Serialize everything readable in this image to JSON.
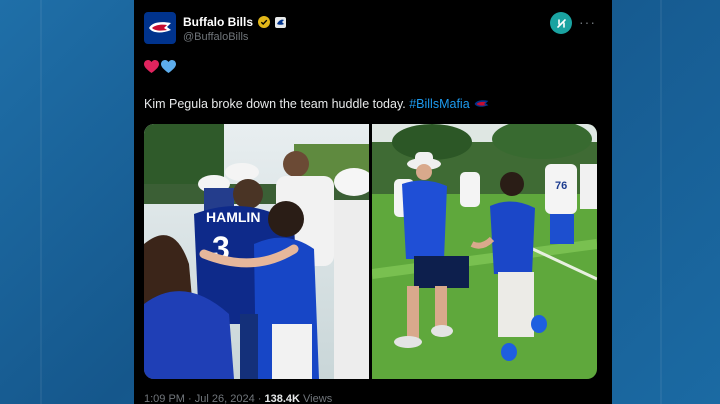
{
  "account": {
    "name": "Buffalo Bills",
    "handle": "@BuffaloBills"
  },
  "tweet": {
    "text": "Kim Pegula broke down the team huddle today. ",
    "hashtag": "#BillsMafia"
  },
  "meta": {
    "time": "1:09 PM",
    "separator": "·",
    "date": "Jul 26, 2024",
    "views_count": "138.4K",
    "views_label": "Views"
  },
  "photos": {
    "left_jersey": "HAMLIN"
  },
  "icons": {
    "verified": "verified-badge-icon",
    "affiliate": "affiliate-badge-icon",
    "grok": "grok-icon",
    "more": "more-icon",
    "hearts": [
      "red-heart-icon",
      "blue-heart-icon"
    ],
    "bills_logo": "bills-logo-icon"
  },
  "colors": {
    "brand_blue": "#00338d",
    "brand_red": "#c60c30",
    "link": "#1d9bf0",
    "background": "#000000",
    "grok_teal": "#1aa3a1",
    "verified_gold": "#e2b719"
  }
}
